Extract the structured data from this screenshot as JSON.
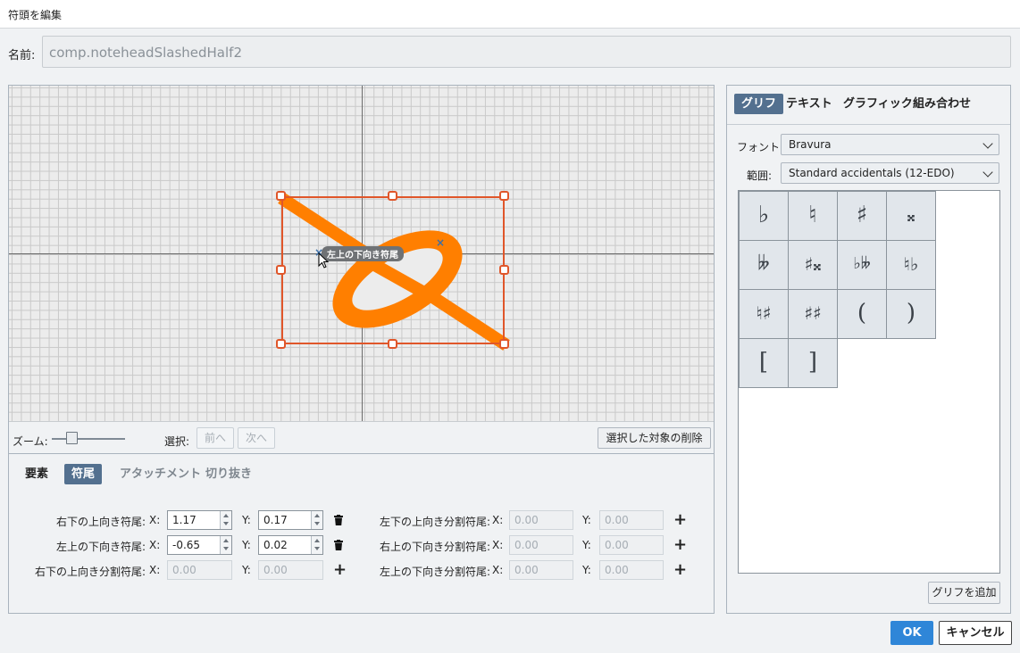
{
  "window": {
    "title": "符頭を編集"
  },
  "name": {
    "label": "名前:",
    "value": "comp.noteheadSlashedHalf2"
  },
  "canvas": {
    "tooltip": "左上の下向き符尾"
  },
  "zoom": {
    "label": "ズーム:",
    "level": 0.3
  },
  "selection": {
    "label": "選択:",
    "prev": "前へ",
    "next": "次へ",
    "delete": "選択した対象の削除"
  },
  "lower_tabs": [
    {
      "label": "要素",
      "state": "normal"
    },
    {
      "label": "符尾",
      "state": "active"
    },
    {
      "label": "アタッチメント",
      "state": "dim"
    },
    {
      "label": "切り抜き",
      "state": "dim"
    }
  ],
  "stems": {
    "left": [
      {
        "label": "右下の上向き符尾:",
        "x": "1.17",
        "y": "0.17",
        "action": "trash-icon"
      },
      {
        "label": "左上の下向き符尾:",
        "x": "-0.65",
        "y": "0.02",
        "action": "trash-icon"
      },
      {
        "label": "右下の上向き分割符尾:",
        "x": "0.00",
        "y": "0.00",
        "action": "plus-icon"
      }
    ],
    "right": [
      {
        "label": "左下の上向き分割符尾:",
        "x": "0.00",
        "y": "0.00",
        "action": "plus-icon"
      },
      {
        "label": "右上の下向き分割符尾:",
        "x": "0.00",
        "y": "0.00",
        "action": "plus-icon"
      },
      {
        "label": "左上の下向き分割符尾:",
        "x": "0.00",
        "y": "0.00",
        "action": "plus-icon"
      }
    ],
    "x_label": "X:",
    "y_label": "Y:"
  },
  "right_tabs": [
    "グリフ",
    "テキスト",
    "グラフィック",
    "組み合わせ"
  ],
  "font": {
    "label": "フォント:",
    "value": "Bravura"
  },
  "range": {
    "label": "範囲:",
    "value": "Standard accidentals (12-EDO)"
  },
  "glyphs": [
    "♭",
    "♮",
    "♯",
    "𝄪",
    "𝄫",
    "♯𝄪",
    "♭𝄫",
    "♮♭",
    "♮♯",
    "♯♯",
    "(",
    ")",
    "[",
    "]"
  ],
  "add_glyph": "グリフを追加",
  "footer": {
    "ok": "OK",
    "cancel": "キャンセル"
  },
  "colors": {
    "accent": "#53708f",
    "selection": "#e0562a",
    "glyph": "#ff7f00",
    "ok": "#2f86d8"
  }
}
